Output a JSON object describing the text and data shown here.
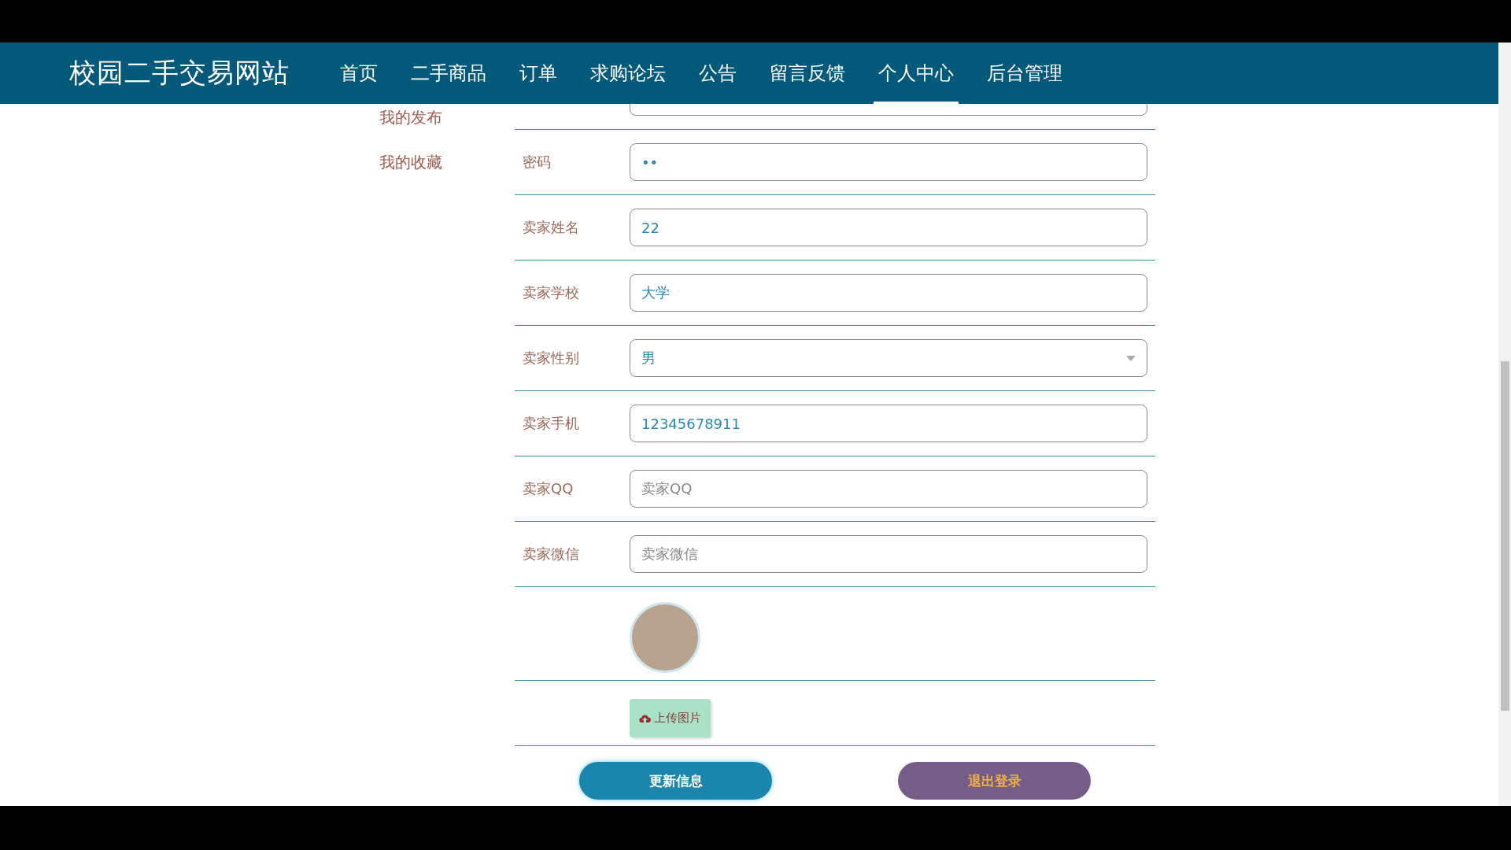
{
  "site_title": "校园二手交易网站",
  "nav": [
    {
      "label": "首页",
      "selected": false
    },
    {
      "label": "二手商品",
      "selected": false
    },
    {
      "label": "订单",
      "selected": false
    },
    {
      "label": "求购论坛",
      "selected": false
    },
    {
      "label": "公告",
      "selected": false
    },
    {
      "label": "留言反馈",
      "selected": false
    },
    {
      "label": "个人中心",
      "selected": true
    },
    {
      "label": "后台管理",
      "selected": false
    }
  ],
  "sidebar": {
    "items": [
      {
        "label": "我的发布"
      },
      {
        "label": "我的收藏"
      }
    ]
  },
  "form": {
    "fields": [
      {
        "kind": "text",
        "label": "密码",
        "value": "••"
      },
      {
        "kind": "text",
        "label": "卖家姓名",
        "value": "22"
      },
      {
        "kind": "text",
        "label": "卖家学校",
        "value": "大学"
      },
      {
        "kind": "select",
        "label": "卖家性别",
        "value": "男"
      },
      {
        "kind": "text",
        "label": "卖家手机",
        "value": "12345678911"
      },
      {
        "kind": "text",
        "label": "卖家QQ",
        "placeholder": "卖家QQ"
      },
      {
        "kind": "text",
        "label": "卖家微信",
        "placeholder": "卖家微信"
      }
    ],
    "upload_button": "上传图片",
    "buttons": [
      {
        "kind": "primary",
        "label": "更新信息"
      },
      {
        "kind": "secondary",
        "label": "退出登录"
      }
    ]
  }
}
